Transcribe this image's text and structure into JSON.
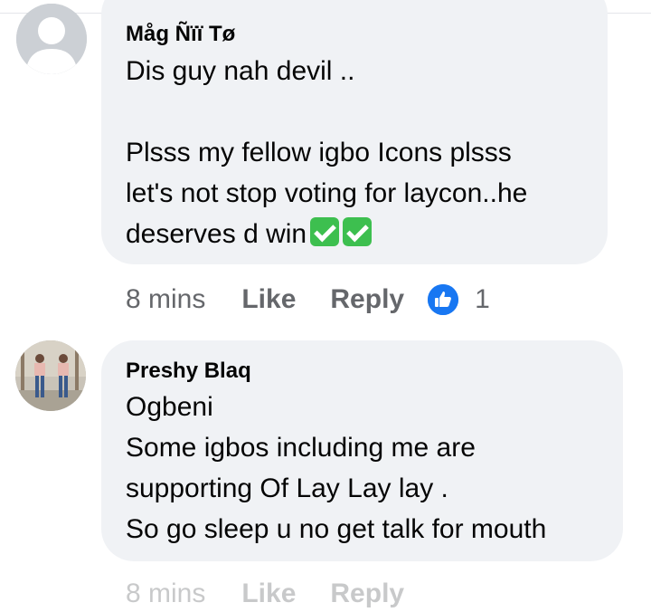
{
  "comments": [
    {
      "author": "Måg Ñïï Tø",
      "text": "Dis guy nah devil ..\n\nPlsss my fellow igbo Icons plsss\nlet's not stop voting for laycon..he\ndeserves d win",
      "emoji": [
        "white-check-mark",
        "white-check-mark"
      ],
      "time": "8 mins",
      "like_label": "Like",
      "reply_label": "Reply",
      "reaction_count": "1",
      "avatar": "default-profile-silhouette"
    },
    {
      "author": "Preshy Blaq",
      "text": "Ogbeni\nSome igbos including me are\nsupporting Of Lay Lay lay .\nSo go sleep u no get talk for mouth",
      "avatar": "profile-photo-two-people"
    }
  ],
  "partial_action_row": {
    "time": "8 mins",
    "like_label": "Like",
    "reply_label": "Reply"
  },
  "colors": {
    "bubble": "#f0f2f5",
    "secondary_text": "#65676b",
    "primary_text": "#050505",
    "like_blue": "#1877f2",
    "check_green": "#3dbf4f"
  }
}
